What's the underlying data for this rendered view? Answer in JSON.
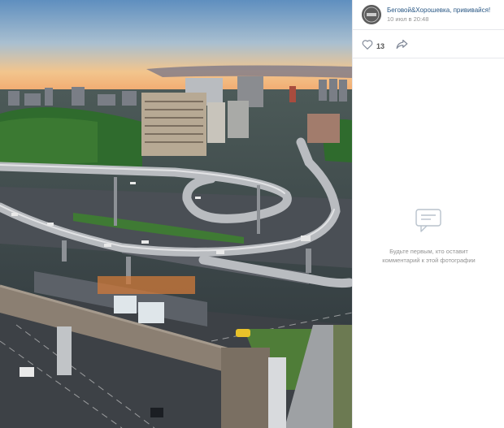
{
  "post": {
    "author": "Беговой&Хорошевка, прививайся!",
    "date": "10 июл в 20:48"
  },
  "actions": {
    "like_count": "13",
    "like_icon": "heart-icon",
    "share_icon": "share-arrow-icon"
  },
  "comments": {
    "empty_icon": "comment-bubbles-icon",
    "empty_line1": "Будьте первым, кто оставит",
    "empty_line2": "комментарий к этой фотографии"
  },
  "colors": {
    "link": "#2a5885",
    "muted": "#939393",
    "divider": "#e7e8ec"
  }
}
